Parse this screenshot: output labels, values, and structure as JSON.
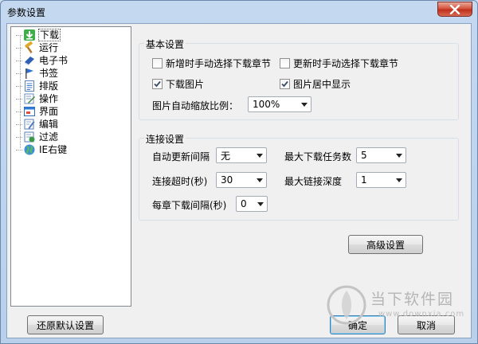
{
  "window": {
    "title": "参数设置"
  },
  "tree": {
    "items": [
      {
        "label": "下载",
        "icon": "download-icon",
        "color": "#2e9e3a"
      },
      {
        "label": "运行",
        "icon": "hammer-icon",
        "color": "#c88a1e"
      },
      {
        "label": "电子书",
        "icon": "book-icon",
        "color": "#2a5db0"
      },
      {
        "label": "书签",
        "icon": "flag-icon",
        "color": "#2a6fd6"
      },
      {
        "label": "排版",
        "icon": "document-icon",
        "color": "#3c78c8"
      },
      {
        "label": "操作",
        "icon": "edit-form-icon",
        "color": "#3a8a3a"
      },
      {
        "label": "界面",
        "icon": "window-icon",
        "color": "#2e7bd6"
      },
      {
        "label": "编辑",
        "icon": "pencil-page-icon",
        "color": "#4a7ac0"
      },
      {
        "label": "过滤",
        "icon": "filter-icon",
        "color": "#3a9a4a"
      },
      {
        "label": "IE右键",
        "icon": "globe-icon",
        "color": "#2a7ad6"
      }
    ]
  },
  "basic": {
    "title": "基本设置",
    "manual_new": "新增时手动选择下载章节",
    "manual_update": "更新时手动选择下载章节",
    "download_images": "下载图片",
    "center_images": "图片居中显示",
    "zoom_label": "图片自动缩放比例：",
    "zoom_value": "100%"
  },
  "conn": {
    "title": "连接设置",
    "auto_update_label": "自动更新间隔",
    "auto_update_value": "无",
    "max_tasks_label": "最大下载任务数",
    "max_tasks_value": "5",
    "timeout_label": "连接超时(秒)",
    "timeout_value": "30",
    "max_depth_label": "最大链接深度",
    "max_depth_value": "1",
    "chapter_interval_label": "每章下载间隔(秒)",
    "chapter_interval_value": "0"
  },
  "buttons": {
    "advanced": "高级设置",
    "restore": "还原默认设置",
    "ok": "确定",
    "cancel": "取消"
  },
  "watermark": {
    "text": "当下软件园",
    "url": "www.downxia.com"
  }
}
